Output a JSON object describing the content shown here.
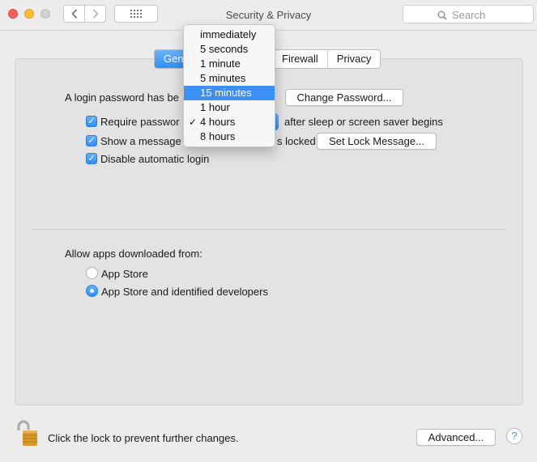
{
  "window": {
    "title": "Security & Privacy"
  },
  "toolbar": {
    "search_placeholder": "Search"
  },
  "tabs": [
    {
      "label": "Gen",
      "active": true
    },
    {
      "label": "Firewall",
      "active": false
    },
    {
      "label": "Privacy",
      "active": false
    }
  ],
  "general": {
    "password_label": "A login password has be",
    "change_password_button": "Change Password...",
    "require_password_label": "Require passwor",
    "require_password_suffix": "after sleep or screen saver begins",
    "show_message_label": "Show a message",
    "show_message_suffix": "s locked",
    "set_lock_message_button": "Set Lock Message...",
    "disable_auto_login_label": "Disable automatic login",
    "allow_apps_label": "Allow apps downloaded from:",
    "radio_app_store": "App Store",
    "radio_identified": "App Store and identified developers",
    "selected_radio": "App Store and identified developers"
  },
  "dropdown": {
    "items": [
      "immediately",
      "5 seconds",
      "1 minute",
      "5 minutes",
      "15 minutes",
      "1 hour",
      "4 hours",
      "8 hours"
    ],
    "highlighted": "15 minutes",
    "checked": "4 hours"
  },
  "footer": {
    "lock_text": "Click the lock to prevent further changes.",
    "advanced_button": "Advanced...",
    "help_label": "?"
  },
  "colors": {
    "accent": "#2f8ef8",
    "highlight": "#3b8ff6",
    "close": "#fc5f57",
    "minimize": "#fdbd2e"
  }
}
